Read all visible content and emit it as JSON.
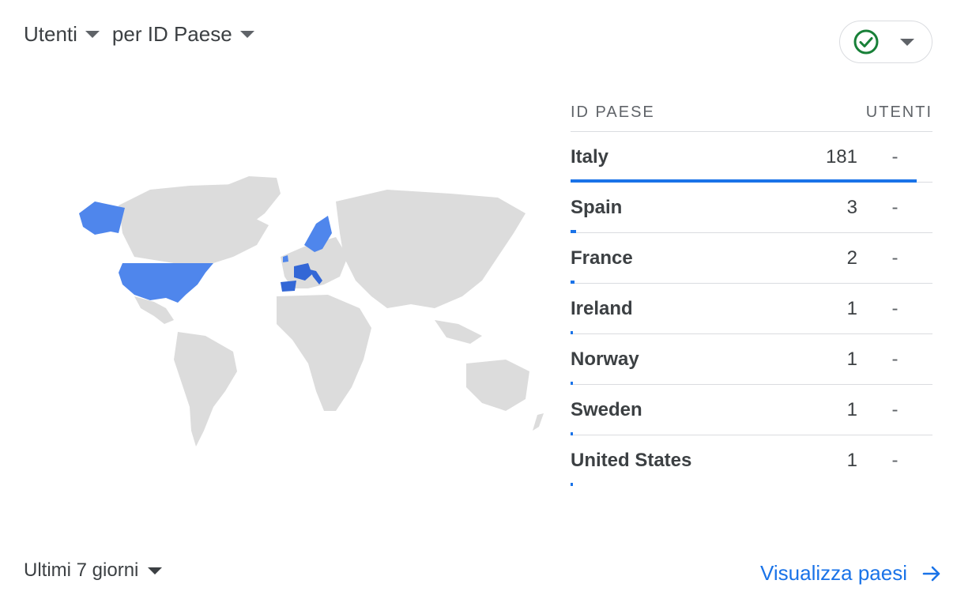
{
  "header": {
    "metric": "Utenti",
    "dimension": "per ID Paese"
  },
  "status_icon": "check-circle-icon",
  "colors": {
    "accent": "#1a73e8",
    "map_land": "#dcdcdc",
    "map_high": "#3367d6",
    "map_low": "#4f86ec",
    "status_green": "#188038"
  },
  "table": {
    "headers": {
      "country": "ID PAESE",
      "users": "UTENTI"
    },
    "rows": [
      {
        "country": "Italy",
        "users": "181",
        "change": "-",
        "share": 1.0
      },
      {
        "country": "Spain",
        "users": "3",
        "change": "-",
        "share": 0.0166
      },
      {
        "country": "France",
        "users": "2",
        "change": "-",
        "share": 0.011
      },
      {
        "country": "Ireland",
        "users": "1",
        "change": "-",
        "share": 0.0055
      },
      {
        "country": "Norway",
        "users": "1",
        "change": "-",
        "share": 0.0055
      },
      {
        "country": "Sweden",
        "users": "1",
        "change": "-",
        "share": 0.0055
      },
      {
        "country": "United States",
        "users": "1",
        "change": "-",
        "share": 0.0055
      }
    ]
  },
  "footer": {
    "range": "Ultimi 7 giorni",
    "link": "Visualizza paesi",
    "link_icon": "arrow-right-icon"
  }
}
